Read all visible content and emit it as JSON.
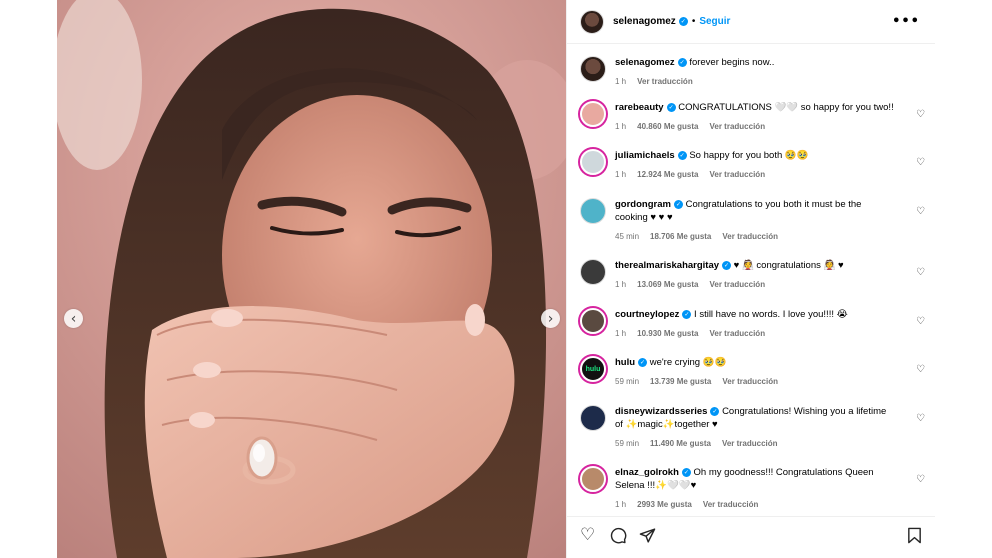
{
  "post": {
    "author": "selenagomez",
    "follow_label": "Seguir",
    "separator": "•",
    "more_glyph": "•••"
  },
  "caption": {
    "user": "selenagomez",
    "text": "forever begins now..",
    "time": "1 h",
    "translate": "Ver traducción"
  },
  "comments": [
    {
      "user": "rarebeauty",
      "text": "CONGRATULATIONS 🤍🤍 so happy for you two!!",
      "time": "1 h",
      "likes": "40.860 Me gusta",
      "translate": "Ver traducción"
    },
    {
      "user": "juliamichaels",
      "text": "So happy for you both 🥹🥹",
      "time": "1 h",
      "likes": "12.924 Me gusta",
      "translate": "Ver traducción"
    },
    {
      "user": "gordongram",
      "text": "Congratulations to you both it must be the cooking ♥ ♥ ♥",
      "time": "45 min",
      "likes": "18.706 Me gusta",
      "translate": "Ver traducción"
    },
    {
      "user": "therealmariskahargitay",
      "text": "♥ 👰 congratulations 👰 ♥",
      "time": "1 h",
      "likes": "13.069 Me gusta",
      "translate": "Ver traducción"
    },
    {
      "user": "courtneylopez",
      "text": "I still have no words. I love you!!!! 😭",
      "time": "1 h",
      "likes": "10.930 Me gusta",
      "translate": "Ver traducción"
    },
    {
      "user": "hulu",
      "text": "we're crying 🥹🥹",
      "time": "59 min",
      "likes": "13.739 Me gusta",
      "translate": "Ver traducción"
    },
    {
      "user": "disneywizardsseries",
      "text": "Congratulations! Wishing you a lifetime of ✨magic✨together ♥",
      "time": "59 min",
      "likes": "11.490 Me gusta",
      "translate": "Ver traducción"
    },
    {
      "user": "elnaz_golrokh",
      "text": "Oh my goodness!!! Congratulations Queen Selena !!!✨🤍🤍♥",
      "time": "1 h",
      "likes": "2993 Me gusta",
      "translate": "Ver traducción"
    }
  ],
  "icons": {
    "like": "heart-icon",
    "comment": "comment-icon",
    "share": "share-icon",
    "save": "bookmark-icon",
    "nav_prev": "chevron-left-icon",
    "nav_next": "chevron-right-icon"
  },
  "colors": {
    "accent": "#0095f6",
    "heart": "#e0245e",
    "story_ring": "#d6249f"
  }
}
